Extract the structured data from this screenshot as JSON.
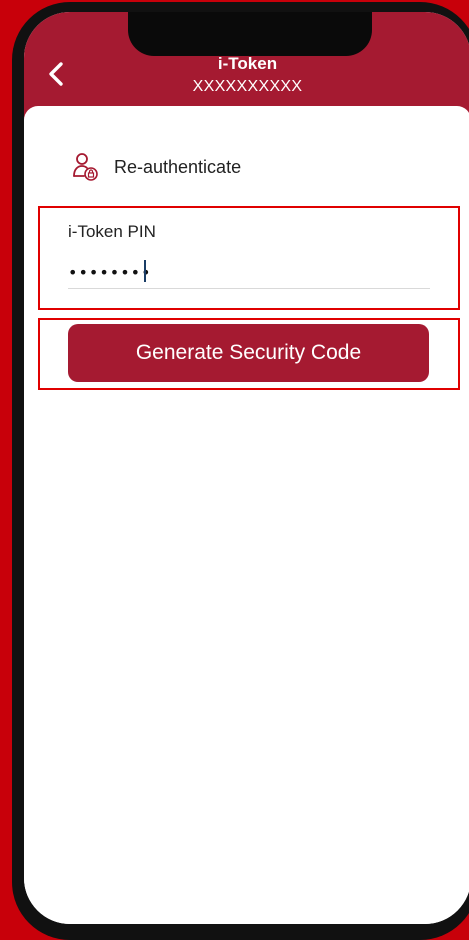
{
  "header": {
    "title": "i-Token",
    "subtitle": "XXXXXXXXXX",
    "back_icon": "chevron-left-icon"
  },
  "reauth": {
    "icon": "user-lock-icon",
    "label": "Re-authenticate"
  },
  "pin_field": {
    "label": "i-Token PIN",
    "value": "••••••••"
  },
  "generate_button": {
    "label": "Generate Security Code"
  },
  "colors": {
    "brand": "#a51a31",
    "background": "#c8000a",
    "highlight": "#e00000"
  }
}
